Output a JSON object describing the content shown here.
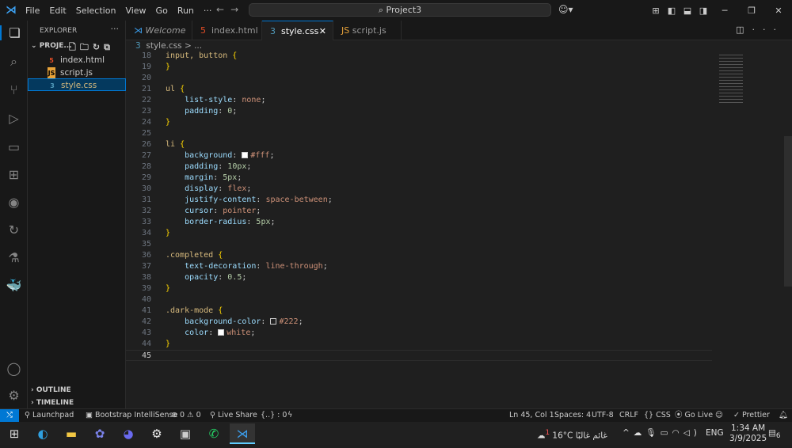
{
  "titlebar": {
    "menu": [
      "File",
      "Edit",
      "Selection",
      "View",
      "Go",
      "Run",
      "···"
    ],
    "search": "Project3"
  },
  "sidebar": {
    "title": "EXPLORER",
    "project": "PROJE...",
    "files": [
      "index.html",
      "script.js",
      "style.css"
    ],
    "outline": "OUTLINE",
    "timeline": "TIMELINE"
  },
  "tabs": [
    "Welcome",
    "index.html",
    "style.css",
    "script.js"
  ],
  "breadcrumb": "style.css > ...",
  "code": [
    {
      "n": "18",
      "t": [
        [
          "sel",
          "input, button "
        ],
        [
          "br",
          "{"
        ]
      ]
    },
    {
      "n": "19",
      "t": [
        [
          "br",
          "}"
        ]
      ]
    },
    {
      "n": "20",
      "t": []
    },
    {
      "n": "21",
      "t": [
        [
          "sel",
          "ul "
        ],
        [
          "br",
          "{"
        ]
      ]
    },
    {
      "n": "22",
      "t": [
        [
          "pu",
          "    "
        ],
        [
          "pr",
          "list-style"
        ],
        [
          "pu",
          ": "
        ],
        [
          "va",
          "none"
        ],
        [
          "pu",
          ";"
        ]
      ]
    },
    {
      "n": "23",
      "t": [
        [
          "pu",
          "    "
        ],
        [
          "pr",
          "padding"
        ],
        [
          "pu",
          ": "
        ],
        [
          "nu",
          "0"
        ],
        [
          "pu",
          ";"
        ]
      ]
    },
    {
      "n": "24",
      "t": [
        [
          "br",
          "}"
        ]
      ]
    },
    {
      "n": "25",
      "t": []
    },
    {
      "n": "26",
      "t": [
        [
          "sel",
          "li "
        ],
        [
          "br",
          "{"
        ]
      ]
    },
    {
      "n": "27",
      "t": [
        [
          "pu",
          "    "
        ],
        [
          "pr",
          "background"
        ],
        [
          "pu",
          ": "
        ],
        [
          "sw",
          "#ffffff"
        ],
        [
          "va",
          "#fff"
        ],
        [
          "pu",
          ";"
        ]
      ]
    },
    {
      "n": "28",
      "t": [
        [
          "pu",
          "    "
        ],
        [
          "pr",
          "padding"
        ],
        [
          "pu",
          ": "
        ],
        [
          "nu",
          "10px"
        ],
        [
          "pu",
          ";"
        ]
      ]
    },
    {
      "n": "29",
      "t": [
        [
          "pu",
          "    "
        ],
        [
          "pr",
          "margin"
        ],
        [
          "pu",
          ": "
        ],
        [
          "nu",
          "5px"
        ],
        [
          "pu",
          ";"
        ]
      ]
    },
    {
      "n": "30",
      "t": [
        [
          "pu",
          "    "
        ],
        [
          "pr",
          "display"
        ],
        [
          "pu",
          ": "
        ],
        [
          "va",
          "flex"
        ],
        [
          "pu",
          ";"
        ]
      ]
    },
    {
      "n": "31",
      "t": [
        [
          "pu",
          "    "
        ],
        [
          "pr",
          "justify-content"
        ],
        [
          "pu",
          ": "
        ],
        [
          "va",
          "space-between"
        ],
        [
          "pu",
          ";"
        ]
      ]
    },
    {
      "n": "32",
      "t": [
        [
          "pu",
          "    "
        ],
        [
          "pr",
          "cursor"
        ],
        [
          "pu",
          ": "
        ],
        [
          "va",
          "pointer"
        ],
        [
          "pu",
          ";"
        ]
      ]
    },
    {
      "n": "33",
      "t": [
        [
          "pu",
          "    "
        ],
        [
          "pr",
          "border-radius"
        ],
        [
          "pu",
          ": "
        ],
        [
          "nu",
          "5px"
        ],
        [
          "pu",
          ";"
        ]
      ]
    },
    {
      "n": "34",
      "t": [
        [
          "br",
          "}"
        ]
      ]
    },
    {
      "n": "35",
      "t": []
    },
    {
      "n": "36",
      "t": [
        [
          "sel",
          ".completed "
        ],
        [
          "br",
          "{"
        ]
      ]
    },
    {
      "n": "37",
      "t": [
        [
          "pu",
          "    "
        ],
        [
          "pr",
          "text-decoration"
        ],
        [
          "pu",
          ": "
        ],
        [
          "va",
          "line-through"
        ],
        [
          "pu",
          ";"
        ]
      ]
    },
    {
      "n": "38",
      "t": [
        [
          "pu",
          "    "
        ],
        [
          "pr",
          "opacity"
        ],
        [
          "pu",
          ": "
        ],
        [
          "nu",
          "0.5"
        ],
        [
          "pu",
          ";"
        ]
      ]
    },
    {
      "n": "39",
      "t": [
        [
          "br",
          "}"
        ]
      ]
    },
    {
      "n": "40",
      "t": []
    },
    {
      "n": "41",
      "t": [
        [
          "sel",
          ".dark-mode "
        ],
        [
          "br",
          "{"
        ]
      ]
    },
    {
      "n": "42",
      "t": [
        [
          "pu",
          "    "
        ],
        [
          "pr",
          "background-color"
        ],
        [
          "pu",
          ": "
        ],
        [
          "sw",
          "#222222"
        ],
        [
          "va",
          "#222"
        ],
        [
          "pu",
          ";"
        ]
      ]
    },
    {
      "n": "43",
      "t": [
        [
          "pu",
          "    "
        ],
        [
          "pr",
          "color"
        ],
        [
          "pu",
          ": "
        ],
        [
          "sw",
          "#ffffff"
        ],
        [
          "va",
          "white"
        ],
        [
          "pu",
          ";"
        ]
      ]
    },
    {
      "n": "44",
      "t": [
        [
          "br",
          "}"
        ]
      ]
    },
    {
      "n": "45",
      "t": []
    }
  ],
  "status": {
    "launchpad": "Launchpad",
    "bootstrap": "Bootstrap IntelliSense",
    "problems": "⊗ 0 ⚠ 0",
    "liveshare": "Live Share",
    "braces": "{..} : 0",
    "position": "Ln 45, Col 1",
    "spaces": "Spaces: 4",
    "encoding": "UTF-8",
    "eol": "CRLF",
    "language": "CSS",
    "golive": "Go Live",
    "prettier": "Prettier"
  },
  "taskbar": {
    "weather_temp": "16°C",
    "weather_desc": "غائم غالبًا",
    "weather_badge": "1",
    "lang": "ENG",
    "time": "1:34 AM",
    "date": "3/9/2025",
    "notifications": "6"
  }
}
